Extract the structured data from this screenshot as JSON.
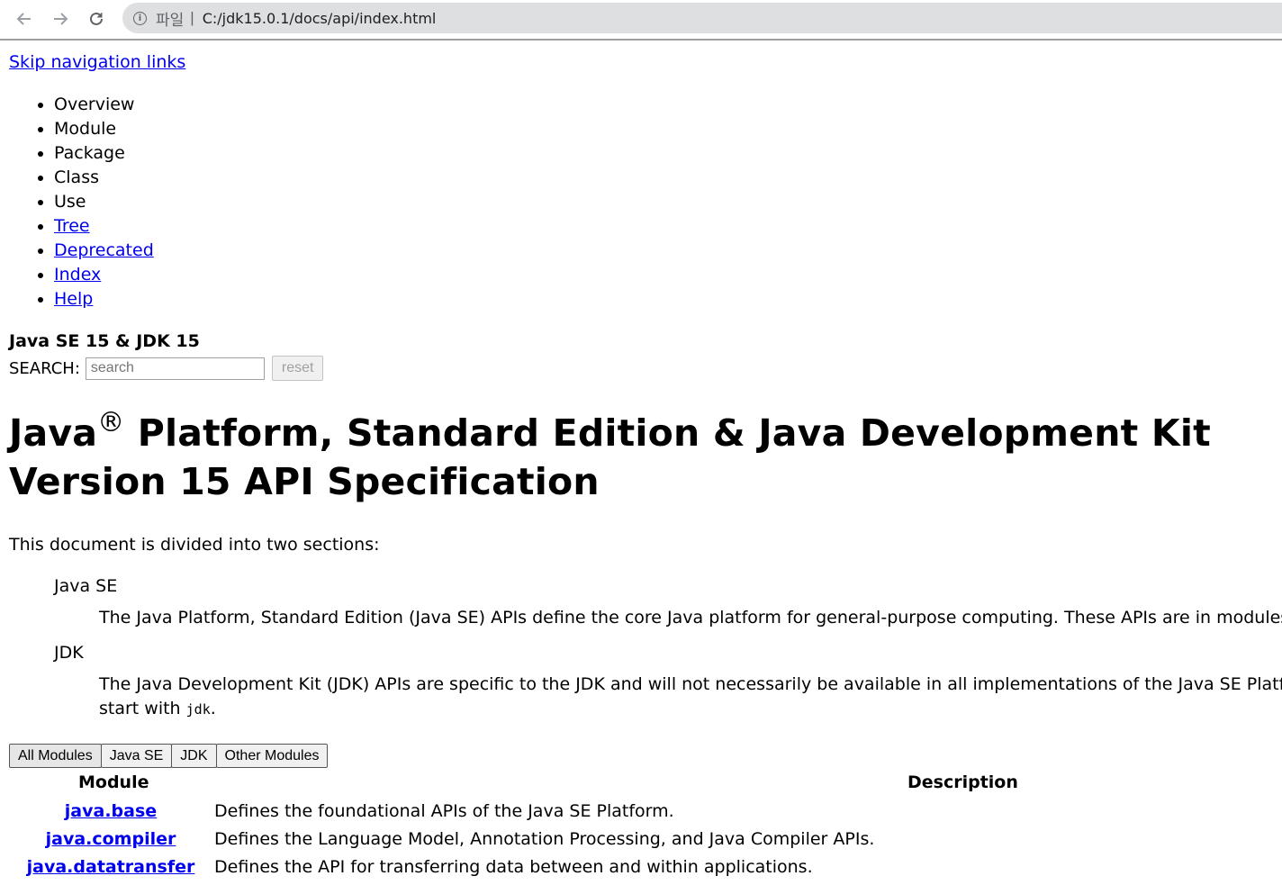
{
  "browser": {
    "back_icon": "arrow-left-icon",
    "forward_icon": "arrow-right-icon",
    "reload_icon": "reload-icon",
    "info_icon": "info-icon",
    "protocol_label": "파일",
    "url": "C:/jdk15.0.1/docs/api/index.html"
  },
  "skip_link": "Skip navigation links",
  "nav": {
    "items": [
      {
        "label": "Overview",
        "link": false
      },
      {
        "label": "Module",
        "link": false
      },
      {
        "label": "Package",
        "link": false
      },
      {
        "label": "Class",
        "link": false
      },
      {
        "label": "Use",
        "link": false
      },
      {
        "label": "Tree",
        "link": true
      },
      {
        "label": "Deprecated",
        "link": true
      },
      {
        "label": "Index",
        "link": true
      },
      {
        "label": "Help",
        "link": true
      }
    ]
  },
  "header": {
    "title": "Java SE 15 & JDK 15",
    "search_label": "SEARCH:",
    "search_placeholder": "search",
    "reset_label": "reset"
  },
  "main": {
    "title_line1_a": "Java",
    "title_reg": "®",
    "title_line1_b": " Platform, Standard Edition & Java Development Kit",
    "title_line2": "Version 15 API Specification",
    "intro": "This document is divided into two sections:",
    "sections": [
      {
        "term": "Java SE",
        "text": "The Java Platform, Standard Edition (Java SE) APIs define the core Java platform for general-purpose computing. These APIs are in modules who"
      },
      {
        "term": "JDK",
        "text": "The Java Development Kit (JDK) APIs are specific to the JDK and will not necessarily be available in all implementations of the Java SE Platform.",
        "text2_prefix": "start with ",
        "text2_code": "jdk",
        "text2_suffix": "."
      }
    ]
  },
  "tabs": [
    "All Modules",
    "Java SE",
    "JDK",
    "Other Modules"
  ],
  "table": {
    "headers": {
      "module": "Module",
      "description": "Description"
    },
    "rows": [
      {
        "name": "java.base",
        "desc": "Defines the foundational APIs of the Java SE Platform."
      },
      {
        "name": "java.compiler",
        "desc": "Defines the Language Model, Annotation Processing, and Java Compiler APIs."
      },
      {
        "name": "java.datatransfer",
        "desc": "Defines the API for transferring data between and within applications."
      }
    ]
  }
}
